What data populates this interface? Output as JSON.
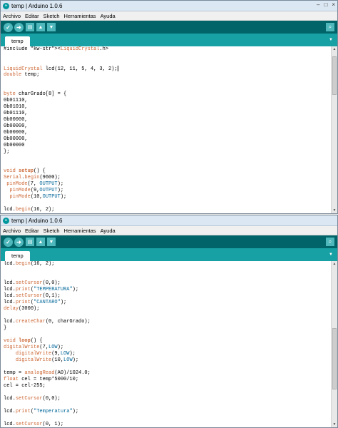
{
  "window": {
    "title": "temp | Arduino 1.0.6",
    "icon_label": "∞",
    "minimize": "–",
    "maximize": "□",
    "close": "×"
  },
  "menu": [
    "Archivo",
    "Editar",
    "Sketch",
    "Herramientas",
    "Ayuda"
  ],
  "toolbar": {
    "verify_icon": "check-icon",
    "upload_icon": "arrow-right-icon",
    "new_icon": "new-file-icon",
    "open_icon": "open-icon",
    "save_icon": "save-icon",
    "serial_icon": "magnifier-icon"
  },
  "tab": {
    "label": "temp"
  },
  "colors": {
    "toolbar": "#006468",
    "tabbar": "#17a1a5",
    "keyword": "#cc6633",
    "constant": "#006699"
  },
  "code_top": [
    "#include <LiquidCrystal.h>",
    "",
    "",
    "LiquidCrystal lcd(12, 11, 5, 4, 3, 2);",
    "double temp;",
    "",
    "",
    "byte charGrado[8] = {",
    "0b01110,",
    "0b01010,",
    "0b01110,",
    "0b00000,",
    "0b00000,",
    "0b00000,",
    "0b00000,",
    "0b00000",
    "};",
    "",
    "",
    "void setup() {",
    "Serial.begin(9600);",
    " pinMode(7, OUTPUT);",
    "  pinMode(9,OUTPUT);",
    "  pinMode(10,OUTPUT);",
    "",
    "lcd.begin(16, 2);"
  ],
  "code_bottom": [
    "lcd.begin(16, 2);",
    "",
    "",
    "lcd.setCursor(0,0);",
    "lcd.print(\"TEMPERATURA\");",
    "lcd.setCursor(0,1);",
    "lcd.print(\"CANTARO\");",
    "delay(3000);",
    "",
    "lcd.createChar(0, charGrado);",
    "}",
    "",
    "void loop() {",
    "digitalWrite(7,LOW);",
    "    digitalWrite(9,LOW);",
    "    digitalWrite(10,LOW);",
    "",
    "temp = analogRead(A0)/1024.0;",
    "float cel = temp*5000/10;",
    "cel = cel-255;",
    "",
    "lcd.setCursor(0,0);",
    "",
    "lcd.print(\"Temperatura\");",
    "",
    "lcd.setCursor(0, 1);"
  ]
}
